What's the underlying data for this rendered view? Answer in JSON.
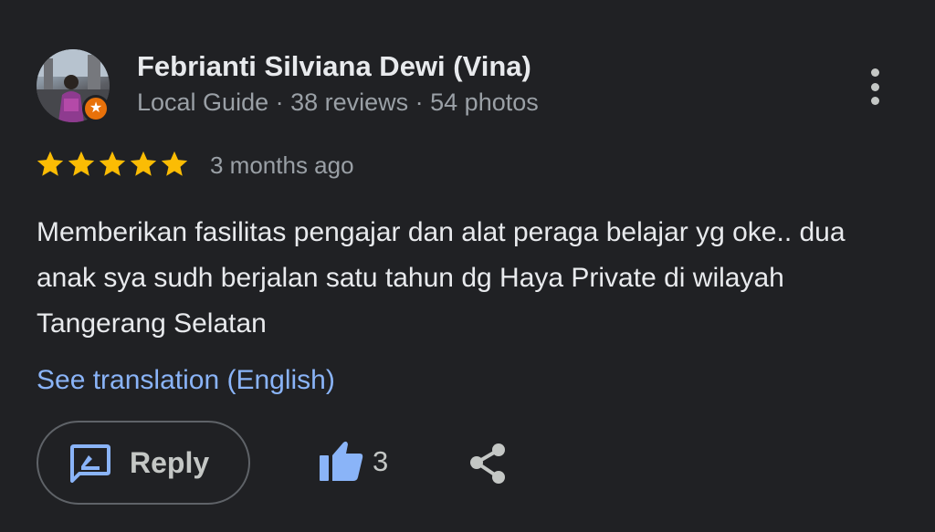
{
  "reviewer": {
    "name": "Febrianti Silviana Dewi (Vina)",
    "meta": "Local Guide · 38 reviews · 54 photos",
    "badge_icon": "local-guide-star-icon"
  },
  "review": {
    "rating": 5,
    "max_rating": 5,
    "time_ago": "3 months ago",
    "text": "Memberikan fasilitas pengajar dan alat peraga belajar yg oke.. dua anak sya sudh berjalan satu tahun dg Haya Private di wilayah Tangerang Selatan",
    "translate_link": "See translation (English)"
  },
  "actions": {
    "reply_label": "Reply",
    "like_count": "3"
  },
  "colors": {
    "background": "#202124",
    "star": "#fbbc04",
    "link": "#8ab4f8",
    "accent_icon": "#8ab4f8",
    "badge": "#e8710a"
  }
}
